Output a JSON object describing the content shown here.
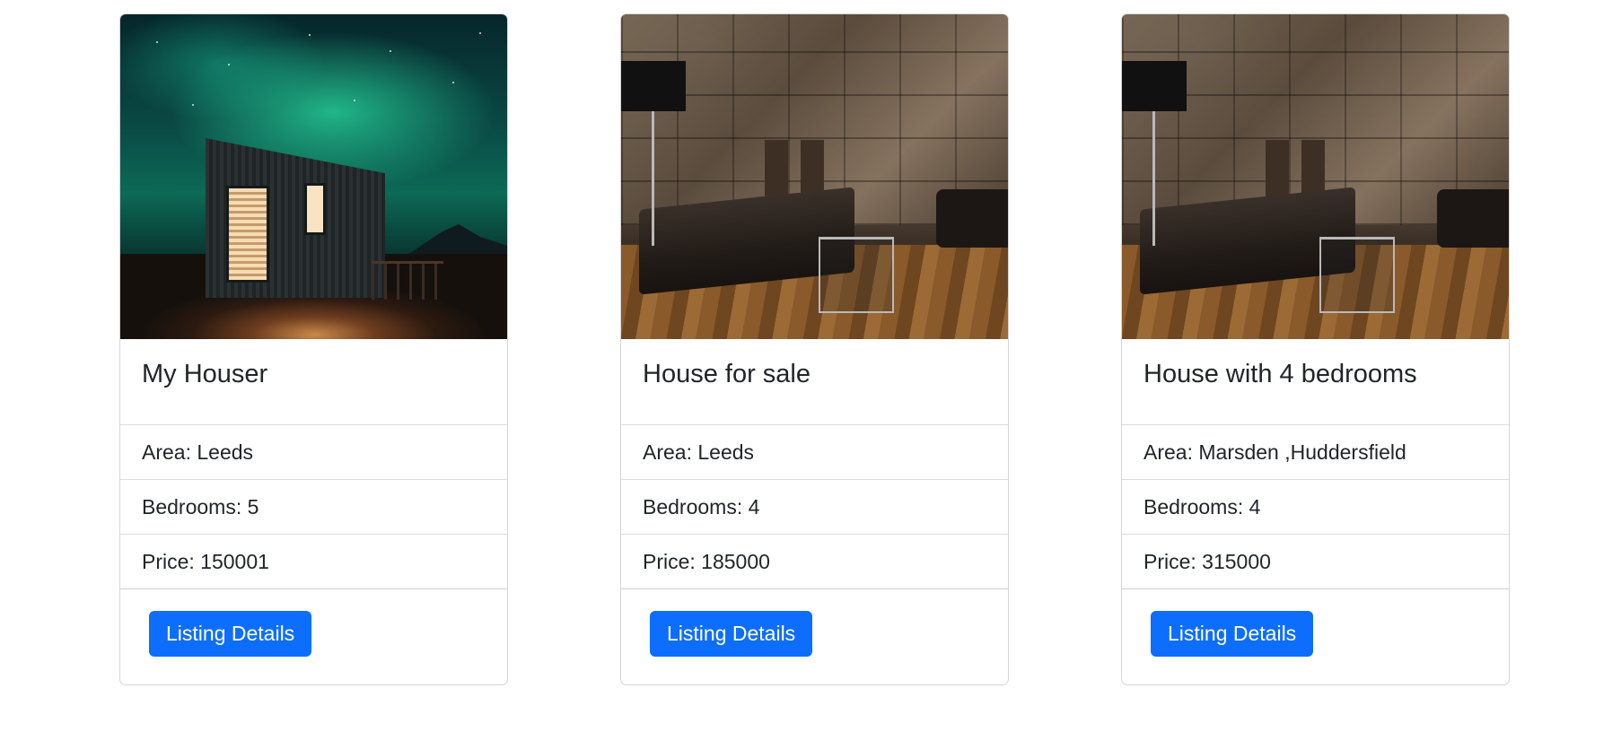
{
  "listings": [
    {
      "image": "aurora-cabin-photo",
      "title": "My Houser",
      "area": "Area: Leeds",
      "bedrooms": "Bedrooms: 5",
      "price": "Price: 150001",
      "button_label": "Listing Details"
    },
    {
      "image": "stone-living-room-photo",
      "title": "House for sale",
      "area": "Area: Leeds",
      "bedrooms": "Bedrooms: 4",
      "price": "Price: 185000",
      "button_label": "Listing Details"
    },
    {
      "image": "stone-living-room-photo",
      "title": "House with 4 bedrooms",
      "area": "Area: Marsden ,Huddersfield",
      "bedrooms": "Bedrooms: 4",
      "price": "Price: 315000",
      "button_label": "Listing Details"
    }
  ],
  "colors": {
    "button_primary": "#0d6efd",
    "border": "#dcdcdc"
  }
}
